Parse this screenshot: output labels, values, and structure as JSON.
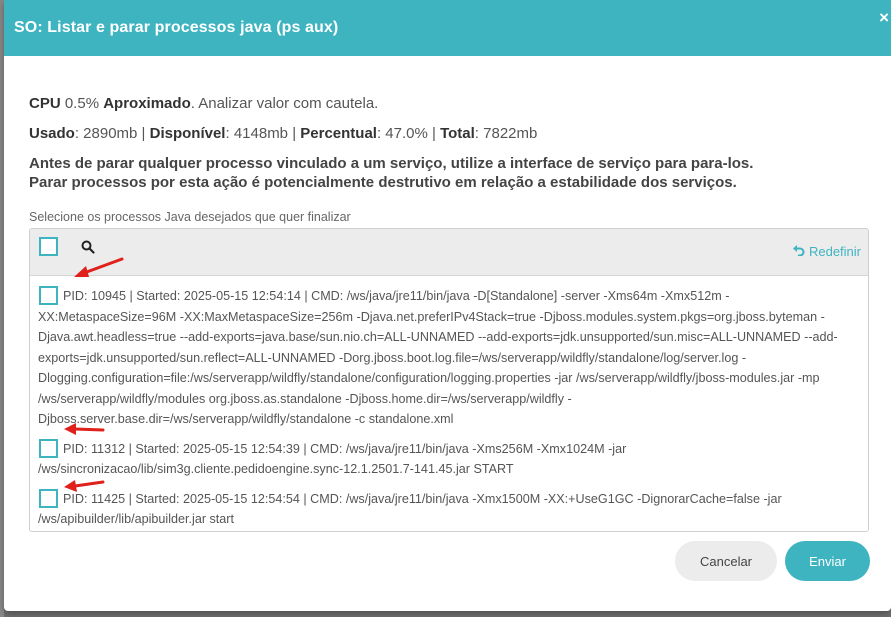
{
  "modal": {
    "title": "SO: Listar e parar processos java (ps aux)",
    "close_icon": "close-x"
  },
  "stats": {
    "cpu_label": "CPU",
    "cpu_value": "0.5%",
    "cpu_approx": "Aproximado",
    "cpu_note": ". Analizar valor com cautela.",
    "used_label": "Usado",
    "used_value": ": 2890mb | ",
    "available_label": "Disponível",
    "available_value": ": 4148mb | ",
    "percent_label": "Percentual",
    "percent_value": ": 47.0% | ",
    "total_label": "Total",
    "total_value": ": 7822mb"
  },
  "warning": {
    "line1": "Antes de parar qualquer processo vinculado a um serviço, utilize a interface de serviço para para-los.",
    "line2": "Parar processos por esta ação é potencialmente destrutivo em relação a estabilidade dos serviços."
  },
  "selection": {
    "label": "Selecione os processos Java desejados que quer finalizar",
    "reset_label": "Redefinir",
    "search_icon": "search-icon",
    "reset_icon": "undo-icon"
  },
  "processes": [
    {
      "text": "PID: 10945 | Started: 2025-05-15 12:54:14 | CMD: /ws/java/jre11/bin/java -D[Standalone] -server -Xms64m -Xmx512m -XX:MetaspaceSize=96M -XX:MaxMetaspaceSize=256m -Djava.net.preferIPv4Stack=true -Djboss.modules.system.pkgs=org.jboss.byteman -Djava.awt.headless=true --add-exports=java.base/sun.nio.ch=ALL-UNNAMED --add-exports=jdk.unsupported/sun.misc=ALL-UNNAMED --add-exports=jdk.unsupported/sun.reflect=ALL-UNNAMED -Dorg.jboss.boot.log.file=/ws/serverapp/wildfly/standalone/log/server.log -Dlogging.configuration=file:/ws/serverapp/wildfly/standalone/configuration/logging.properties -jar /ws/serverapp/wildfly/jboss-modules.jar -mp /ws/serverapp/wildfly/modules org.jboss.as.standalone -Djboss.home.dir=/ws/serverapp/wildfly -Djboss.server.base.dir=/ws/serverapp/wildfly/standalone -c standalone.xml",
      "checked": false
    },
    {
      "text": "PID: 11312 | Started: 2025-05-15 12:54:39 | CMD: /ws/java/jre11/bin/java -Xms256M -Xmx1024M -jar /ws/sincronizacao/lib/sim3g.cliente.pedidoengine.sync-12.1.2501.7-141.45.jar START",
      "checked": false
    },
    {
      "text": "PID: 11425 | Started: 2025-05-15 12:54:54 | CMD: /ws/java/jre11/bin/java -Xmx1500M -XX:+UseG1GC -DignorarCache=false -jar /ws/apibuilder/lib/apibuilder.jar start",
      "checked": false
    }
  ],
  "footer": {
    "cancel_label": "Cancelar",
    "send_label": "Enviar"
  },
  "colors": {
    "accent": "#3fb4c1",
    "annotation_arrow": "#e0201b"
  }
}
